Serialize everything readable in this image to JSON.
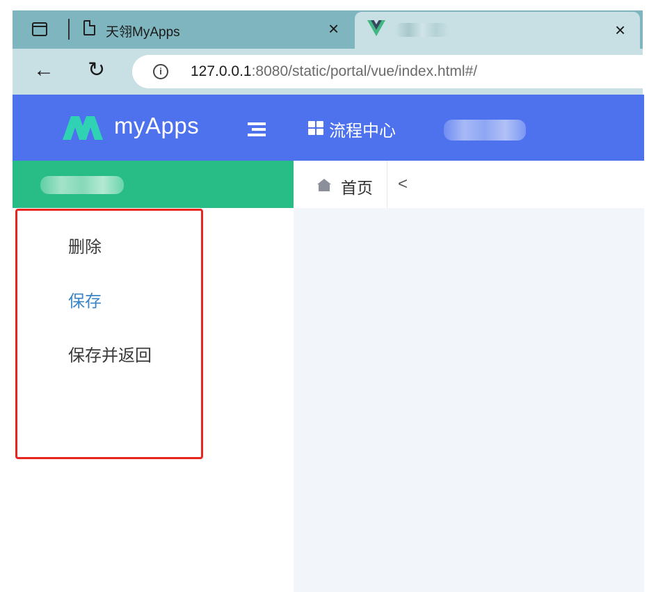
{
  "browser": {
    "tabs": [
      {
        "title": "天翎MyApps",
        "close": "×"
      },
      {
        "title": "",
        "close": "×"
      }
    ],
    "nav": {
      "back": "←",
      "reload": "↻"
    },
    "address": {
      "info": "i",
      "url_host": "127.0.0.1",
      "url_rest": ":8080/static/portal/vue/index.html#/"
    }
  },
  "header": {
    "logo_text": "myApps",
    "nav_link": "流程中心",
    "brand_color": "#4e72ee"
  },
  "sidebar": {
    "header_color": "#28bd86",
    "items": [
      {
        "label": "删除",
        "active": false
      },
      {
        "label": "保存",
        "active": true
      },
      {
        "label": "保存并返回",
        "active": false
      }
    ]
  },
  "breadcrumb": {
    "home_label": "首页",
    "chevron": "<"
  },
  "icons": [
    "sidebar-toggle-icon",
    "page-icon",
    "vue-logo-icon",
    "close-icon",
    "back-arrow-icon",
    "reload-icon",
    "info-icon",
    "logo-icon",
    "menu-collapse-icon",
    "grid-icon",
    "home-icon",
    "chevron-left-icon"
  ]
}
